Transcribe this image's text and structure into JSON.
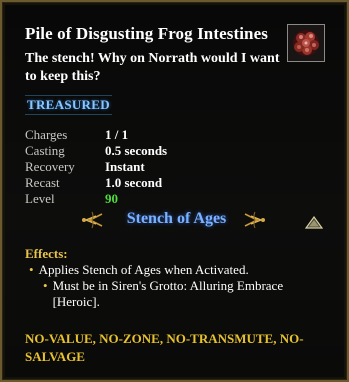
{
  "item": {
    "title": "Pile of Disgusting Frog Intestines",
    "icon": "frog-intestines-icon",
    "description": "The stench!  Why on Norrath would I want to keep this?",
    "tag": "TREASURED"
  },
  "stats": [
    {
      "label": "Charges",
      "value": "1 / 1"
    },
    {
      "label": "Casting",
      "value": "0.5 seconds"
    },
    {
      "label": "Recovery",
      "value": "Instant"
    },
    {
      "label": "Recast",
      "value": "1.0 second"
    },
    {
      "label": "Level",
      "value": "90"
    }
  ],
  "set": {
    "name": "Stench of Ages"
  },
  "effects": {
    "label": "Effects:",
    "main": "Applies Stench of Ages when Activated.",
    "requirement": "Must be in Siren's Grotto: Alluring Embrace [Heroic]."
  },
  "flags": "NO-VALUE, NO-ZONE, NO-TRANSMUTE, NO-SALVAGE",
  "colors": {
    "border": "#6b5a2e",
    "treasured": "#8cc4ff",
    "level_value": "#4fdc3c",
    "set_name": "#7ab0ff",
    "effects_label": "#e8c44a",
    "flags": "#e8c22e"
  }
}
